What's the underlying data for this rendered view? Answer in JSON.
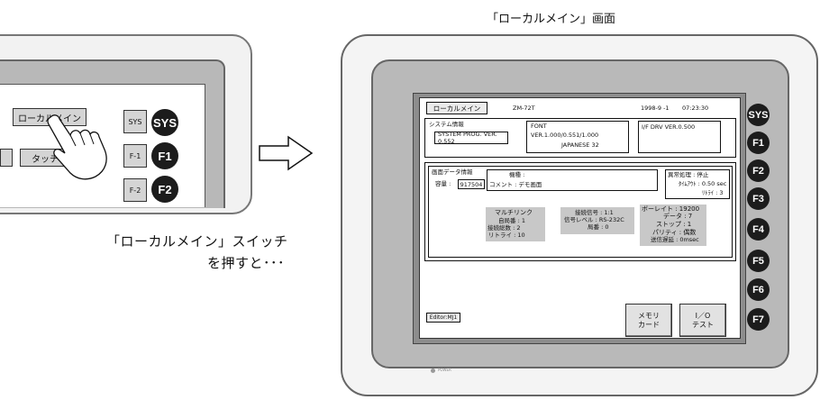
{
  "right_title": "「ローカルメイン」画面",
  "left_caption_line1": "「ローカルメイン」スイッチ",
  "left_caption_line2": "を押すと･･･",
  "left_panel": {
    "local_main_label": "ローカルメイン",
    "touch_label": "タッチ",
    "sys_small": "SYS",
    "f1_small": "F-1",
    "f2_small": "F-2",
    "keys": [
      "SYS",
      "F1",
      "F2"
    ]
  },
  "screen": {
    "local_main_button": "ローカルメイン",
    "model": "ZM-72T",
    "date": "1998-9 -1",
    "time": "07:23:30",
    "system_info_title": "システム情報",
    "system_prog": "SYSTEM PROG. VER. 0.552",
    "font_title": "FONT",
    "font_version": "VER.1.000/0.551/1.000",
    "font_lang": "JAPANESE 32",
    "if_drv": "I/F DRV VER.0.500",
    "screen_data_title": "画面データ情報",
    "capacity_label": "容量 :",
    "capacity_value": "917504",
    "model_label": "機種 :",
    "comment_label": "コメント : デモ画面",
    "error_handling": "異常処理 : 停止",
    "timeout": "ﾀｲﾑｱｳﾄ : 0.50 sec",
    "retry_top": "ﾘﾄﾗｲ : 3",
    "multilink": "マルチリンク",
    "own_station": "自局番 : 1",
    "total_connected": "接続総数 : 2",
    "retry_multi": "リトライ : 10",
    "conn_signal": "接続信号 : 1:1",
    "signal_level": "信号レベル : RS-232C",
    "station_no": "局番 : 0",
    "baud_rate": "ボーレイト : 19200",
    "data_bits": "データ : 7",
    "stop_bits": "ストップ : 1",
    "parity": "パリティ : 偶数",
    "send_delay": "送信遅延 : 0msec",
    "editor": "Editor:MJ1",
    "memory_card_l1": "メモリ",
    "memory_card_l2": "カード",
    "io_test_l1": "I／O",
    "io_test_l2": "テスト"
  },
  "side_keys": [
    "SYS",
    "F1",
    "F2",
    "F3",
    "F4",
    "F5",
    "F6",
    "F7"
  ],
  "power_label": "POWER"
}
